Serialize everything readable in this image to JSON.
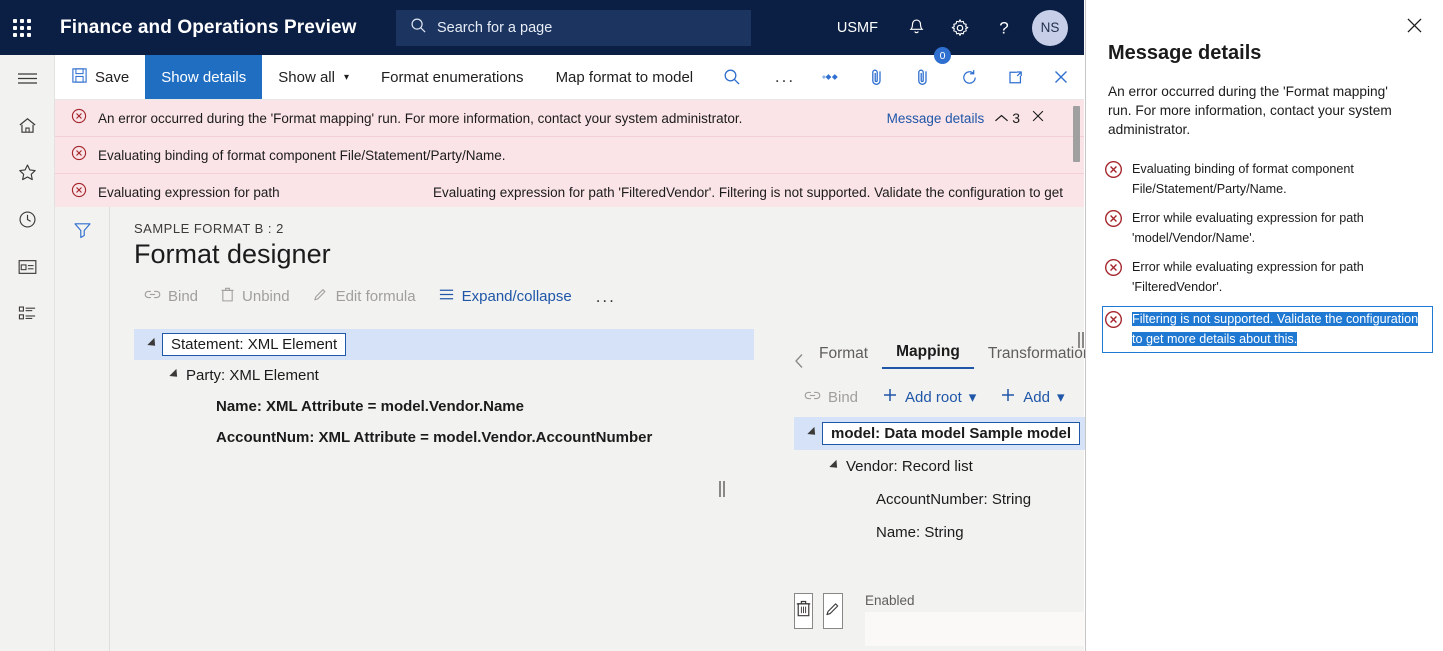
{
  "topnav": {
    "waffle_icon": "waffle-grid-icon",
    "app_title": "Finance and Operations Preview",
    "search_placeholder": "Search for a page",
    "search_icon": "search-icon",
    "company": "USMF",
    "notifications_icon": "bell-icon",
    "settings_icon": "gear-icon",
    "help_icon": "question-mark-icon",
    "avatar_initials": "NS"
  },
  "rail": {
    "items": [
      {
        "name": "hamburger-menu-icon"
      },
      {
        "name": "home-icon"
      },
      {
        "name": "favorites-star-icon"
      },
      {
        "name": "recent-clock-icon"
      },
      {
        "name": "workspaces-icon"
      },
      {
        "name": "modules-list-icon"
      }
    ]
  },
  "commandbar": {
    "save_label": "Save",
    "save_icon": "save-disk-icon",
    "show_details_label": "Show details",
    "show_all_label": "Show all",
    "format_enumerations_label": "Format enumerations",
    "map_format_to_model_label": "Map format to model",
    "search_icon": "search-icon",
    "overflow_label": "...",
    "office_icon": "office-apps-icon",
    "attach_icon": "attachment-icon",
    "attach_count": "0",
    "refresh_icon": "refresh-icon",
    "popout_icon": "open-in-new-window-icon",
    "close_icon": "close-icon"
  },
  "messagebar": {
    "messages": [
      {
        "icon": "error-circle-icon",
        "text": "An error occurred during the 'Format mapping' run. For more information, contact your system administrator."
      },
      {
        "icon": "error-circle-icon",
        "text": "Evaluating binding of format component File/Statement/Party/Name."
      },
      {
        "icon": "error-circle-icon",
        "text": "Evaluating expression for path",
        "text2": "Evaluating expression for path 'FilteredVendor'. Filtering is not supported. Validate the configuration to get"
      }
    ],
    "details_link": "Message details",
    "collapse_count": "3",
    "collapse_icon": "chevron-up-icon",
    "close_icon": "close-icon"
  },
  "workspace": {
    "filter_icon": "filter-funnel-icon",
    "breadcrumb": "SAMPLE FORMAT B : 2",
    "page_title": "Format designer",
    "toolbar": [
      {
        "label": "Bind",
        "icon": "link-chain-icon",
        "state": "disabled"
      },
      {
        "label": "Unbind",
        "icon": "trash-bin-icon",
        "state": "disabled"
      },
      {
        "label": "Edit formula",
        "icon": "pencil-icon",
        "state": "disabled"
      },
      {
        "label": "Expand/collapse",
        "icon": "list-lines-icon",
        "state": "link"
      },
      {
        "label": "...",
        "icon": "ellipsis-icon",
        "state": "more"
      }
    ],
    "format_tree": [
      {
        "label": "Statement: XML Element",
        "indent": 0,
        "expander": true,
        "selected": true,
        "boxed": true,
        "bold": false
      },
      {
        "label": "Party: XML Element",
        "indent": 1,
        "expander": true,
        "selected": false,
        "boxed": false,
        "bold": false
      },
      {
        "label": "Name: XML Attribute = model.Vendor.Name",
        "indent": 2,
        "expander": false,
        "selected": false,
        "boxed": false,
        "bold": true
      },
      {
        "label": "AccountNum: XML Attribute = model.Vendor.AccountNumber",
        "indent": 2,
        "expander": false,
        "selected": false,
        "boxed": false,
        "bold": true
      }
    ]
  },
  "rightpane": {
    "back_icon": "chevron-left-icon",
    "forward_icon": "chevron-right-icon",
    "tabs": [
      {
        "label": "Format",
        "active": false
      },
      {
        "label": "Mapping",
        "active": true
      },
      {
        "label": "Transformations",
        "active": false
      }
    ],
    "toolbar": [
      {
        "label": "Bind",
        "icon": "link-chain-icon",
        "state": "disabled"
      },
      {
        "label": "Add root",
        "icon": "plus-icon",
        "state": "link",
        "chevron": true
      },
      {
        "label": "Add",
        "icon": "plus-icon",
        "state": "link",
        "chevron": true
      },
      {
        "label": "...",
        "icon": "ellipsis-icon",
        "state": "more"
      }
    ],
    "model_tree": [
      {
        "label": "model: Data model Sample model",
        "indent": 0,
        "expander": true,
        "selected": true,
        "boxed": true,
        "bold": true
      },
      {
        "label": "Vendor: Record list",
        "indent": 1,
        "expander": true,
        "selected": false,
        "boxed": false,
        "bold": false
      },
      {
        "label": "AccountNumber: String",
        "indent": 2,
        "expander": false,
        "selected": false,
        "boxed": false,
        "bold": false
      },
      {
        "label": "Name: String",
        "indent": 2,
        "expander": false,
        "selected": false,
        "boxed": false,
        "bold": false
      }
    ],
    "delete_icon": "trash-bin-icon",
    "edit_icon": "pencil-icon",
    "enabled_label": "Enabled",
    "enabled_value": ""
  },
  "details_panel": {
    "close_icon": "close-icon",
    "title": "Message details",
    "lead": "An error occurred during the 'Format mapping' run. For more information, contact your system administrator.",
    "items": [
      {
        "icon": "error-circle-icon",
        "text": "Evaluating binding of format component File/Statement/Party/Name.",
        "highlighted": false
      },
      {
        "icon": "error-circle-icon",
        "text": "Error while evaluating expression for path 'model/Vendor/Name'.",
        "highlighted": false
      },
      {
        "icon": "error-circle-icon",
        "text": "Error while evaluating expression for path 'FilteredVendor'.",
        "highlighted": false
      },
      {
        "icon": "error-circle-icon",
        "text": "Filtering is not supported. Validate the configuration to get more details about this.",
        "highlighted": true
      }
    ]
  },
  "colors": {
    "nav_background": "#0b1f44",
    "accent_blue": "#1f6ec2",
    "link_blue": "#1f56a8",
    "error_red": "#a4262c",
    "error_background": "#fbe4e7",
    "selection_blue": "#d6e2f8",
    "highlight_blue": "#1f78d1",
    "surface": "#f2f2f0"
  }
}
